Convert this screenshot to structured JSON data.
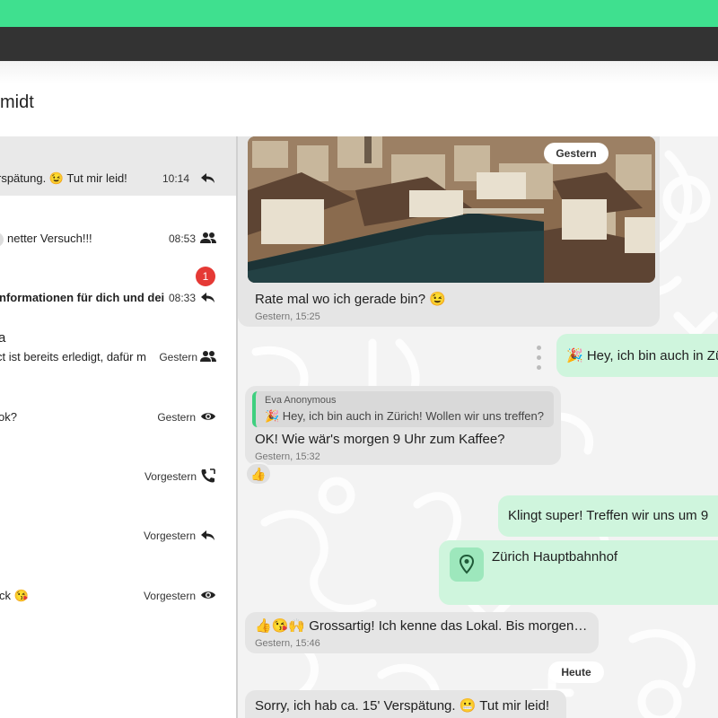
{
  "header": {
    "title": "midt"
  },
  "chats": [
    {
      "name": "",
      "preview": "rspätung. 😉 Tut mir leid!",
      "time": "10:14",
      "status_icon": "reply-icon",
      "selected": true
    },
    {
      "name": "",
      "preview": "netter Versuch!!!",
      "time": "08:53",
      "status_icon": "group-icon"
    },
    {
      "name": "",
      "preview": "nformationen für dich und dei",
      "time": "08:33",
      "status_icon": "reply-icon",
      "unread": "1",
      "bold": true
    },
    {
      "name": "a",
      "preview": "ct ist bereits erledigt, dafür m",
      "time": "Gestern",
      "status_icon": "group-icon"
    },
    {
      "name": "",
      "preview": "ok?",
      "time": "Gestern",
      "status_icon": "eye-icon"
    },
    {
      "name": "",
      "preview": "",
      "time": "Vorgestern",
      "status_icon": "phone-icon"
    },
    {
      "name": "",
      "preview": "",
      "time": "Vorgestern",
      "status_icon": "reply-icon"
    },
    {
      "name": "",
      "preview": "ck 😘",
      "time": "Vorgestern",
      "status_icon": "eye-icon"
    }
  ],
  "conversation": {
    "date_gestern": "Gestern",
    "date_heute": "Heute",
    "messages": {
      "photo_caption": "Rate mal wo ich gerade bin? 😉",
      "photo_time": "Gestern, 15:25",
      "out1": "🎉 Hey, ich bin auch in Zü",
      "quote_author": "Eva Anonymous",
      "quote_text": "🎉 Hey, ich bin auch in Zürich! Wollen wir uns treffen?",
      "reply_text": "OK! Wie wär's morgen 9 Uhr zum Kaffee?",
      "reply_time": "Gestern, 15:32",
      "reaction": "👍",
      "out2": "Klingt super! Treffen wir uns um 9",
      "location_name": "Zürich Hauptbahnhof",
      "in3": "👍😘🙌 Grossartig! Ich kenne das Lokal. Bis morgen…",
      "in3_time": "Gestern, 15:46",
      "in4": "Sorry, ich hab ca. 15' Verspätung. 😬 Tut mir leid!"
    }
  },
  "colors": {
    "accent": "#3fe08f",
    "dark_bar": "#333333",
    "bubble_out": "#cff5dd",
    "bubble_in": "#e5e5e5",
    "badge": "#e53935"
  }
}
